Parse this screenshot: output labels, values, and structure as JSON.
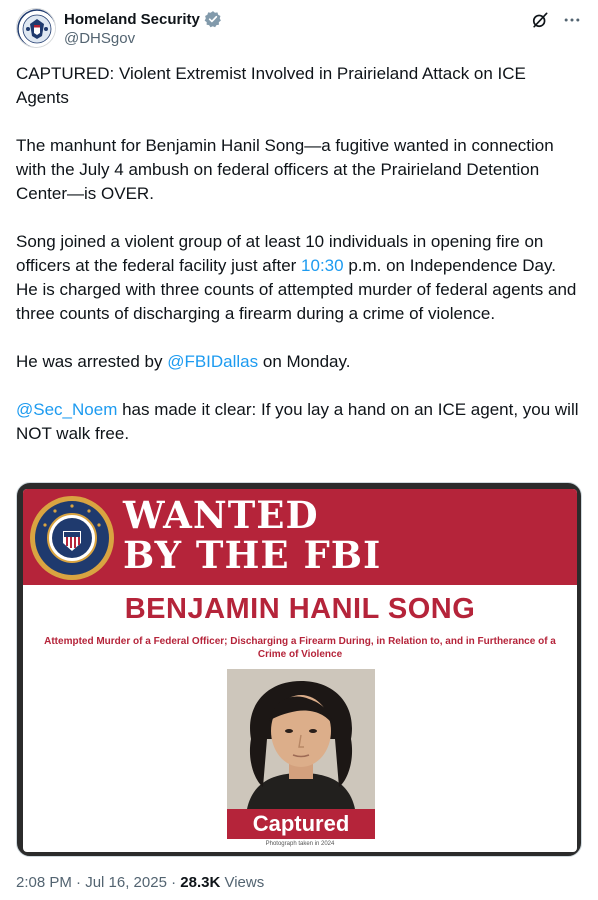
{
  "account": {
    "display_name": "Homeland Security",
    "handle": "@DHSgov",
    "verified": true,
    "avatar_icon": "dhs-seal-icon"
  },
  "header_icons": [
    "grok-icon",
    "more-icon"
  ],
  "tweet": {
    "p1": "CAPTURED: Violent Extremist Involved in Prairieland Attack on ICE Agents",
    "p2": "The manhunt for Benjamin Hanil Song—a fugitive wanted in connection with the July 4 ambush on federal officers at the Prairieland Detention Center—is OVER.",
    "p3_before": "Song joined a violent group of at least 10 individuals in opening fire on officers at the federal facility just after ",
    "p3_time": "10:30",
    "p3_after": " p.m. on Independence Day. He is charged with three counts of attempted murder of federal agents and three counts of discharging a firearm during a crime of violence.",
    "p4_before": "He was arrested by ",
    "p4_mention": "@FBIDallas",
    "p4_after": " on Monday.",
    "p5_mention": "@Sec_Noem",
    "p5_after": " has made it clear: If you lay a hand on an ICE agent, you will NOT walk free."
  },
  "poster": {
    "title": "WANTED\nBY THE FBI",
    "name": "BENJAMIN HANIL SONG",
    "charges": "Attempted Murder of a Federal Officer; Discharging a Firearm During, in Relation to, and in Furtherance of a Crime of Violence",
    "status": "Captured",
    "photo_caption": "Photograph taken in 2024",
    "seal_icon": "fbi-seal-icon",
    "accent_color": "#b5243a"
  },
  "meta": {
    "timestamp": "2:08 PM · Jul 16, 2025 · ",
    "views_count": "28.3K",
    "views_label": " Views"
  },
  "colors": {
    "link": "#1d9bf0",
    "verified": "#829aab",
    "text": "#0f1419",
    "secondary": "#536471"
  }
}
